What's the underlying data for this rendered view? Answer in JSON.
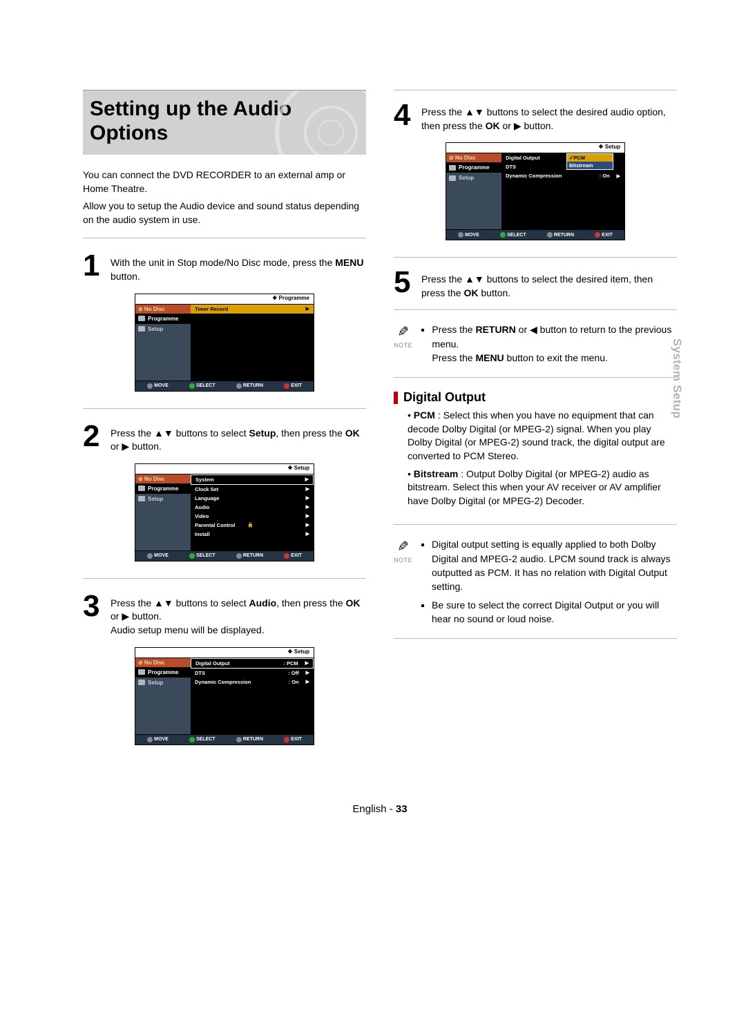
{
  "title": "Setting up the Audio Options",
  "side_tab": "System Setup",
  "intro1": "You can connect the DVD RECORDER to an external amp or Home Theatre.",
  "intro2": "Allow you to setup the Audio device and sound status depending on the audio system in use.",
  "steps": {
    "s1": {
      "num": "1",
      "text_a": "With the unit in Stop mode/No Disc mode, press the ",
      "b1": "MENU",
      "text_b": " button."
    },
    "s2": {
      "num": "2",
      "text_a": "Press the ▲▼ buttons to select ",
      "b1": "Setup",
      "text_b": ", then press the ",
      "b2": "OK",
      "text_c": " or ▶ button."
    },
    "s3": {
      "num": "3",
      "text_a": "Press the ▲▼ buttons to select ",
      "b1": "Audio",
      "text_b": ", then press the ",
      "b2": "OK",
      "text_c": " or ▶ button.",
      "text_d": "Audio setup menu will be displayed."
    },
    "s4": {
      "num": "4",
      "text_a": "Press the ▲▼ buttons to select the desired audio option, then press the ",
      "b1": "OK",
      "text_b": " or ▶ button."
    },
    "s5": {
      "num": "5",
      "text_a": "Press the ▲▼ buttons to select the desired item, then press the ",
      "b1": "OK",
      "text_b": " button."
    }
  },
  "note1": {
    "line1_a": "Press the ",
    "line1_b1": "RETURN",
    "line1_b": " or ◀ button to return to the previous menu.",
    "line2_a": "Press the ",
    "line2_b1": "MENU",
    "line2_b": " button to exit the menu."
  },
  "section_digital_output": "Digital Output",
  "defs": {
    "pcm_term": "PCM",
    "pcm_text": " : Select this when you have no equipment that can decode Dolby Digital (or MPEG-2) signal. When you play Dolby Digital (or MPEG-2) sound track, the digital output are converted to PCM Stereo.",
    "bit_term": "Bitstream",
    "bit_text": " : Output Dolby Digital (or MPEG-2) audio as bitstream. Select this when your AV receiver or AV amplifier have Dolby Digital (or MPEG-2) Decoder."
  },
  "note2": {
    "li1": "Digital output setting is equally applied to both Dolby Digital and MPEG-2 audio. LPCM sound track is always outputted as PCM. It has no relation with Digital Output setting.",
    "li2": "Be sure to select the correct Digital Output or you will hear no sound or loud noise."
  },
  "note_label": "NOTE",
  "osd": {
    "nodisc": "⊘  No Disc",
    "side_programme": "Programme",
    "side_setup": "Setup",
    "crumb_programme": "❖  Programme",
    "crumb_setup": "❖  Setup",
    "timer_record": "Timer Record",
    "system": "System",
    "clock_set": "Clock Set",
    "language": "Language",
    "audio": "Audio",
    "video": "Video",
    "parental": "Parental Control",
    "install": "Install",
    "digital_output": "Digital Output",
    "dts": "DTS",
    "dyn_comp": "Dynamic Compression",
    "pcm": "PCM",
    "off": "Off",
    "on": "On",
    "bitstream": "Bitstream",
    "check": "✓",
    "colon_pcm": ": PCM",
    "colon_off": ": Off",
    "colon_on": ": On",
    "foot_move": "MOVE",
    "foot_select": "SELECT",
    "foot_return": "RETURN",
    "foot_exit": "EXIT"
  },
  "footer": {
    "lang": "English",
    "sep": " - ",
    "page": "33"
  }
}
